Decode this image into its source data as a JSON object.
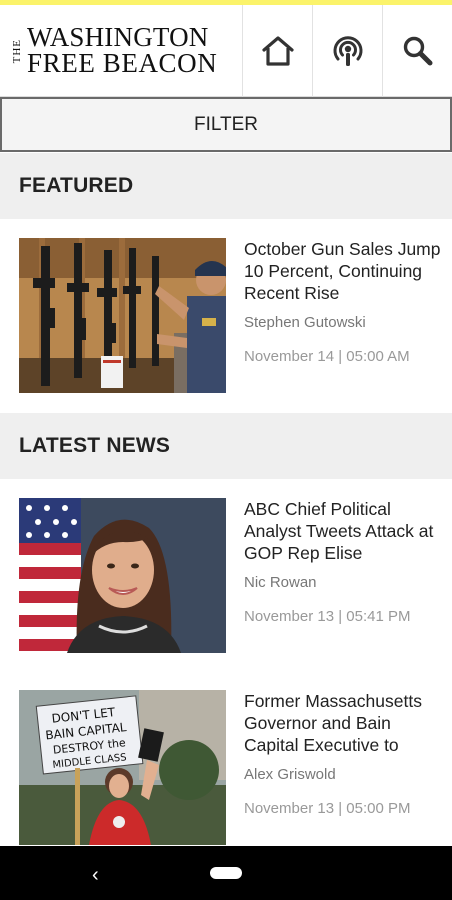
{
  "header": {
    "logo_the": "THE",
    "logo_line1": "WASHINGTON",
    "logo_line2": "FREE BEACON",
    "icons": [
      "home-icon",
      "podcast-icon",
      "search-icon"
    ]
  },
  "filter": {
    "label": "FILTER"
  },
  "featured": {
    "heading": "FEATURED",
    "articles": [
      {
        "title": "October Gun Sales Jump 10 Percent, Continuing Recent Rise",
        "author": "Stephen Gutowski",
        "date": "November 14 | 05:00 AM"
      }
    ]
  },
  "latest": {
    "heading": "LATEST NEWS",
    "articles": [
      {
        "title": "ABC Chief Political Analyst Tweets Attack at GOP Rep Elise",
        "author": "Nic Rowan",
        "date": "November 13 | 05:41 PM"
      },
      {
        "title": "Former Massachusetts Governor and Bain Capital Executive to",
        "author": "Alex Griswold",
        "date": "November 13 | 05:00 PM",
        "sign_text": [
          "DON'T LET",
          "BAIN CAPITAL",
          "DESTROY the",
          "MIDDLE CLASS"
        ]
      }
    ]
  },
  "colors": {
    "accent": "#fbf36a",
    "section_bg": "#efefef",
    "nav_bar": "#000000"
  }
}
